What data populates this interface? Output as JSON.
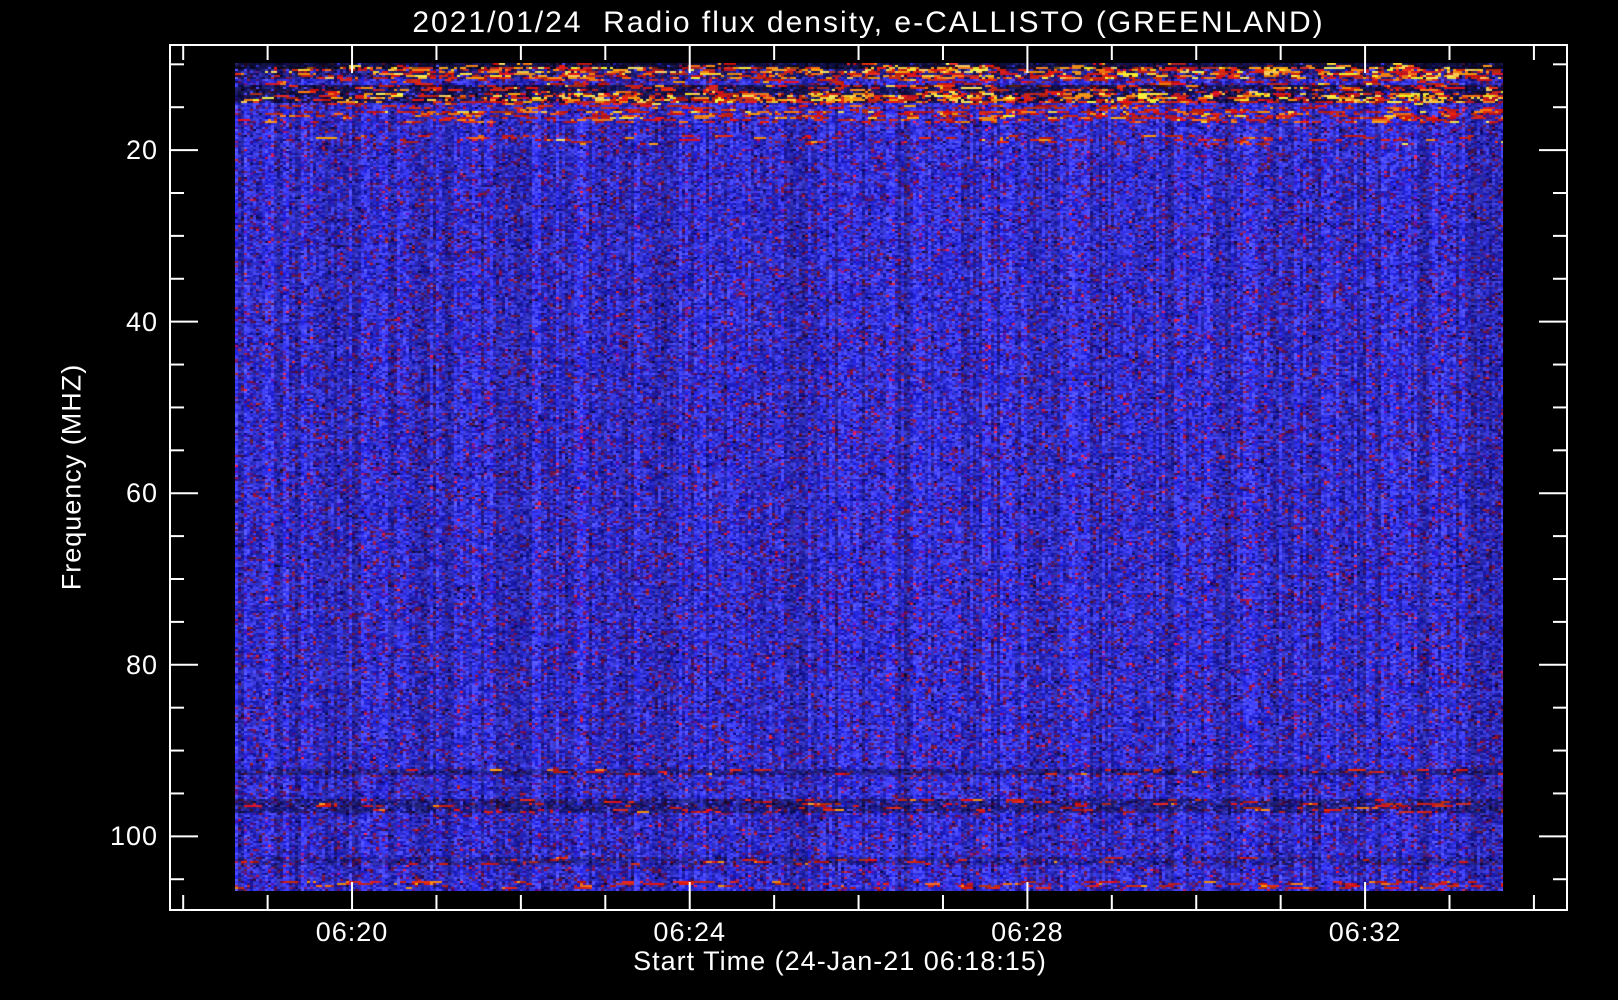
{
  "chart_data": {
    "type": "heatmap",
    "title": "2021/01/24  Radio flux density, e-CALLISTO (GREENLAND)",
    "x_axis": {
      "title": "Start Time (24-Jan-21 06:18:15)",
      "major_ticks": [
        {
          "label": "06:20",
          "minute": 2
        },
        {
          "label": "06:24",
          "minute": 6
        },
        {
          "label": "06:28",
          "minute": 10
        },
        {
          "label": "06:32",
          "minute": 14
        }
      ],
      "minor_ticks": {
        "from_minute": 0,
        "to_minute": 16,
        "step_minutes": 1
      }
    },
    "y_axis": {
      "title": "Frequency (MHZ)",
      "inverted": true,
      "major_ticks": [
        {
          "label": "20",
          "mhz": 20
        },
        {
          "label": "40",
          "mhz": 40
        },
        {
          "label": "60",
          "mhz": 60
        },
        {
          "label": "80",
          "mhz": 80
        },
        {
          "label": "100",
          "mhz": 100
        }
      ],
      "minor_ticks": {
        "from_mhz": 10,
        "to_mhz": 105,
        "step_mhz": 5
      }
    },
    "data_extent": {
      "freq_mhz": [
        10,
        106
      ],
      "time_start": "06:18:40",
      "time_end": "06:33:40"
    },
    "grid": false,
    "legend": null,
    "colors": {
      "background": "#000000",
      "frame_and_text": "#ffffff",
      "noise_base_blue": "#2e2ee8",
      "noise_bright_blue": "#4b4bff",
      "noise_purple": "#6a22a0",
      "noise_maroon": "#8c1c5a",
      "rfi_red": "#d42315",
      "rfi_orange": "#f07818",
      "rfi_yellow": "#f7e24a",
      "rfi_dark_row": "#05051a"
    },
    "description": "Blue background noise spectrogram with horizontal RFI bands of red/orange/yellow dashes near 10-17 MHz and faint dark bands near 92-103 MHz",
    "rfi_bands": [
      {
        "f0_mhz": 10.0,
        "f1_mhz": 10.4,
        "density": 0.1,
        "darken": 0.2,
        "darken_p": 0.95,
        "colors": {
          "red": 0.45,
          "orange": 0.4,
          "yellow": 0.15
        }
      },
      {
        "f0_mhz": 10.4,
        "f1_mhz": 11.55,
        "density": 0.42,
        "darken": 0.45,
        "darken_p": 0.75,
        "colors": {
          "red": 0.55,
          "orange": 0.27,
          "yellow": 0.18
        },
        "hotspots": [
          [
            0.12,
            0.145,
            2.2
          ],
          [
            0.26,
            0.28,
            2.0
          ],
          [
            0.51,
            0.535,
            2.2
          ],
          [
            0.54,
            0.59,
            1.7
          ],
          [
            0.81,
            0.84,
            1.9
          ],
          [
            0.91,
            0.97,
            2.1
          ]
        ]
      },
      {
        "f0_mhz": 11.55,
        "f1_mhz": 12.55,
        "density": 0.1,
        "colors": {
          "red": 0.8,
          "orange": 0.15,
          "yellow": 0.05
        }
      },
      {
        "f0_mhz": 12.55,
        "f1_mhz": 13.3,
        "density": 0.16,
        "darken": 0.3,
        "darken_p": 0.9,
        "colors": {
          "red": 0.75,
          "orange": 0.2,
          "yellow": 0.05
        }
      },
      {
        "f0_mhz": 13.3,
        "f1_mhz": 14.35,
        "density": 0.55,
        "darken": 0.3,
        "darken_p": 0.85,
        "colors": {
          "red": 0.5,
          "orange": 0.28,
          "yellow": 0.22
        },
        "hotspots": [
          [
            0.28,
            0.3,
            2.3
          ],
          [
            0.46,
            0.5,
            2.2
          ],
          [
            0.555,
            0.585,
            2.2
          ],
          [
            0.7,
            0.735,
            2.0
          ],
          [
            0.86,
            0.95,
            2.1
          ]
        ]
      },
      {
        "f0_mhz": 14.35,
        "f1_mhz": 15.6,
        "density": 0.13,
        "colors": {
          "red": 0.8,
          "orange": 0.15,
          "yellow": 0.05
        }
      },
      {
        "f0_mhz": 15.6,
        "f1_mhz": 16.7,
        "density": 0.26,
        "colors": {
          "red": 0.7,
          "orange": 0.25,
          "yellow": 0.05
        }
      },
      {
        "f0_mhz": 18.4,
        "f1_mhz": 19.3,
        "density": 0.11,
        "colors": {
          "red": 0.85,
          "orange": 0.12,
          "yellow": 0.03
        }
      },
      {
        "f0_mhz": 92.2,
        "f1_mhz": 92.8,
        "density": 0.05,
        "darken": 0.55,
        "darken_p": 0.85,
        "colors": {
          "red": 0.9,
          "orange": 0.1,
          "yellow": 0.0
        }
      },
      {
        "f0_mhz": 95.8,
        "f1_mhz": 97.3,
        "density": 0.08,
        "darken": 0.5,
        "darken_p": 0.8,
        "colors": {
          "red": 0.9,
          "orange": 0.1,
          "yellow": 0.0
        }
      },
      {
        "f0_mhz": 102.5,
        "f1_mhz": 103.2,
        "density": 0.04,
        "darken": 0.6,
        "darken_p": 0.7,
        "colors": {
          "red": 0.9,
          "orange": 0.1,
          "yellow": 0.0
        }
      },
      {
        "f0_mhz": 105.2,
        "f1_mhz": 106.0,
        "density": 0.12,
        "colors": {
          "red": 0.8,
          "orange": 0.2,
          "yellow": 0.0
        }
      }
    ]
  }
}
